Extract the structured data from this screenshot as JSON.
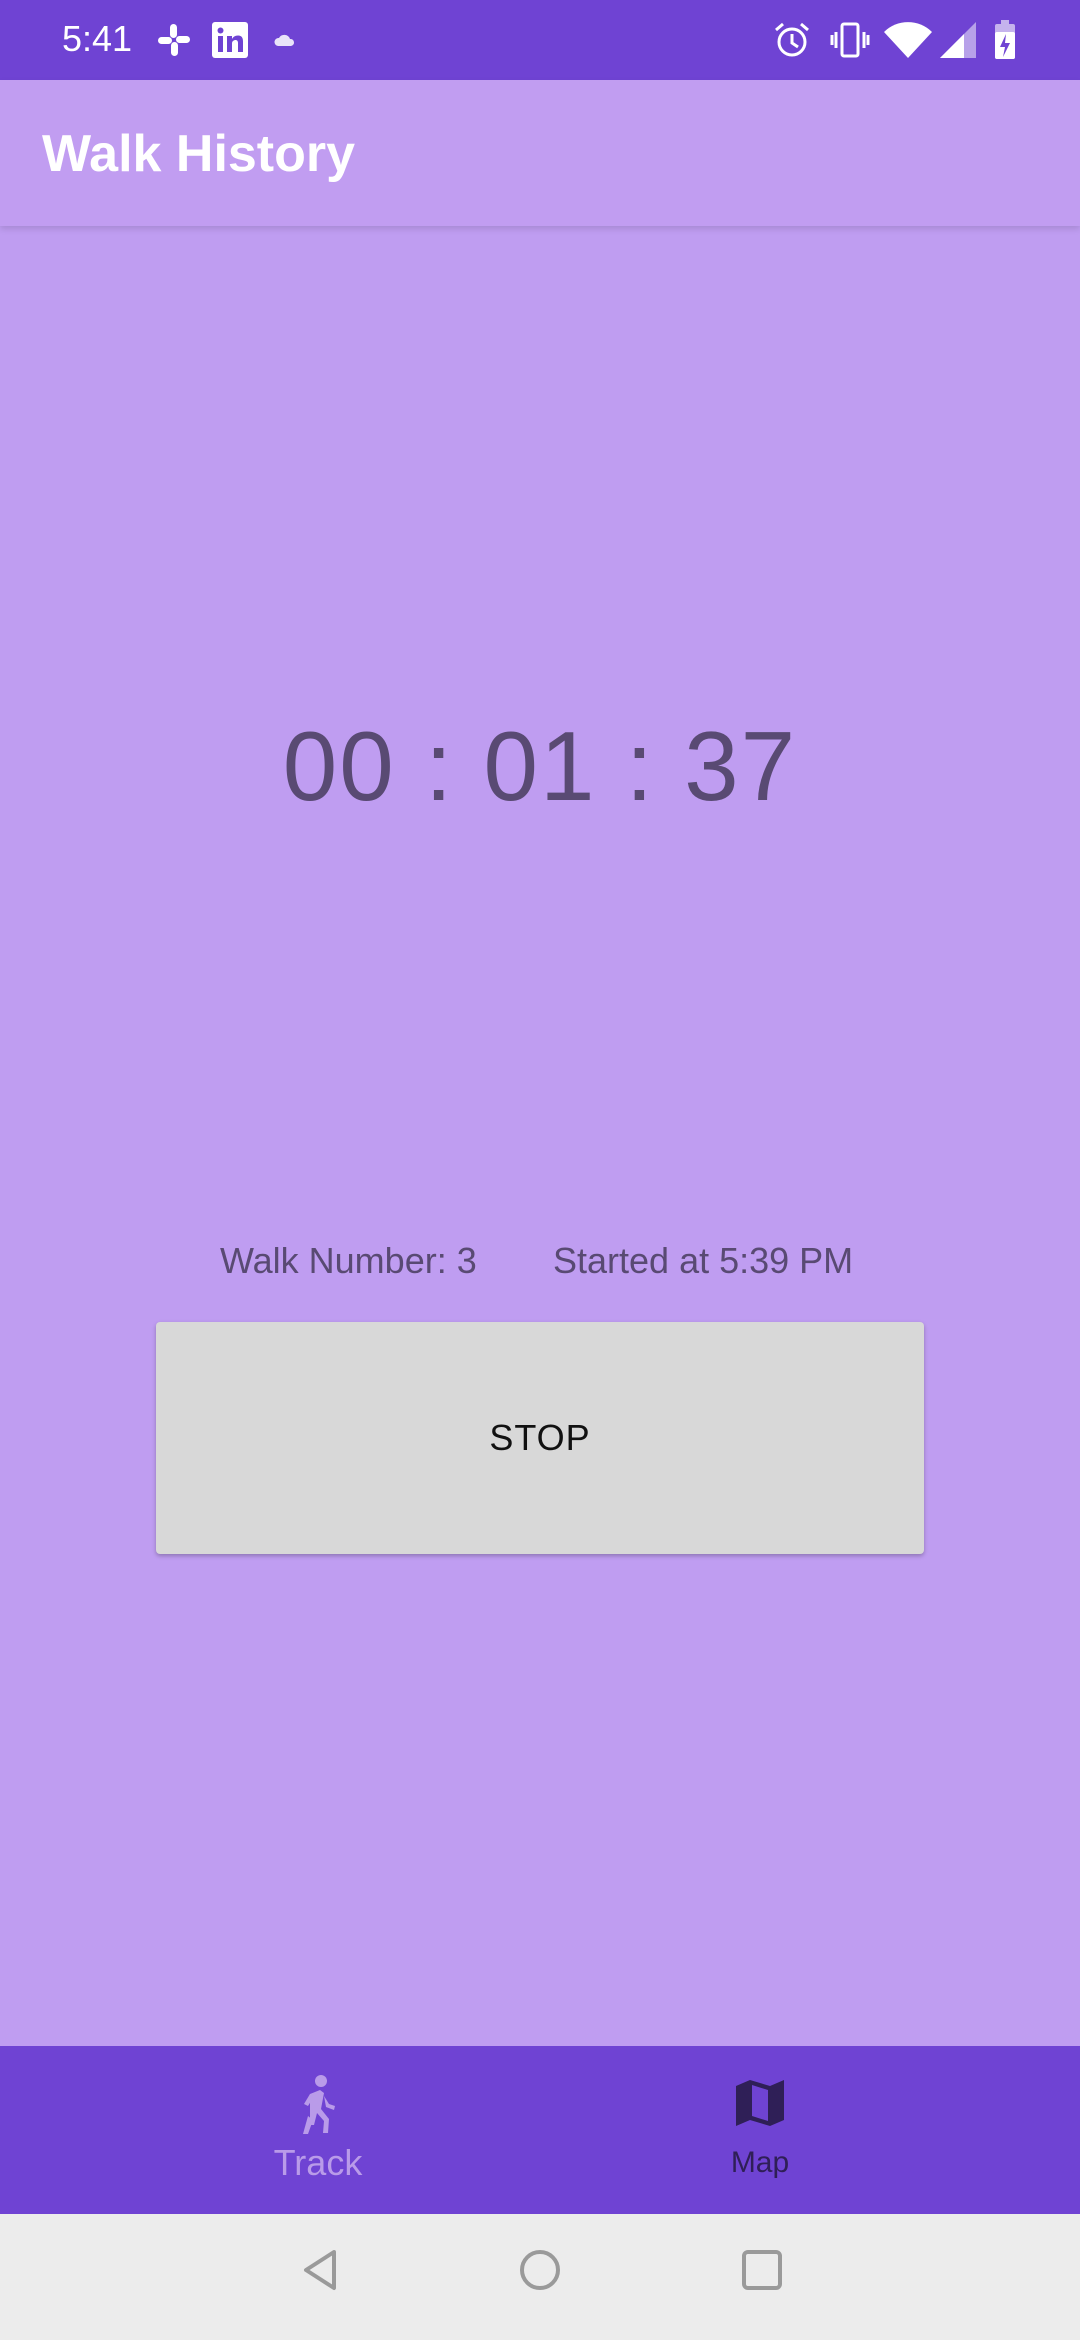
{
  "status_bar": {
    "time": "5:41",
    "left_icons": [
      "slack-icon",
      "linkedin-icon",
      "cloud-icon"
    ],
    "right_icons": [
      "alarm-icon",
      "vibrate-icon",
      "wifi-icon",
      "cell-signal-icon",
      "battery-charging-icon"
    ]
  },
  "app_bar": {
    "title": "Walk History"
  },
  "timer": {
    "display": "00 : 01 : 37"
  },
  "walk": {
    "number_label": "Walk Number: 3",
    "started_label": "Started at 5:39 PM"
  },
  "stop_button": {
    "label": "STOP"
  },
  "bottom_nav": {
    "items": [
      {
        "label": "Track",
        "icon": "walk-icon"
      },
      {
        "label": "Map",
        "icon": "map-icon"
      }
    ]
  },
  "system_nav": {
    "buttons": [
      "back-icon",
      "home-icon",
      "recents-icon"
    ]
  },
  "colors": {
    "status_bar": "#6f43d3",
    "app_bar": "#c19df1",
    "background": "#bf9df1",
    "bottom_nav": "#6f43d3",
    "button": "#d8d8d8"
  }
}
